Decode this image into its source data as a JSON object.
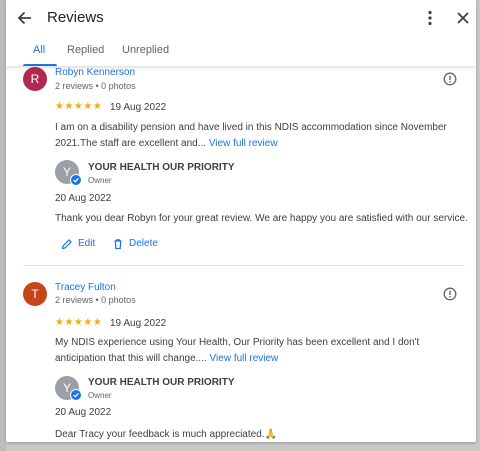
{
  "header": {
    "title": "Reviews",
    "back_icon": "arrow-left-icon",
    "more_icon": "more-vert-icon",
    "close_icon": "close-icon"
  },
  "tabs": [
    {
      "label": "All",
      "active": true
    },
    {
      "label": "Replied",
      "active": false
    },
    {
      "label": "Unreplied",
      "active": false
    }
  ],
  "colors": {
    "accent": "#1a73e8",
    "star": "#f9ab00"
  },
  "reviews": [
    {
      "avatar_letter": "R",
      "avatar_color": "#b0294f",
      "name": "Robyn Kennerson",
      "meta": "2 reviews • 0 photos",
      "rating": 5,
      "stars": "★★★★★",
      "date": "19 Aug 2022",
      "text": "I am on a disability pension and have lived in this NDIS accommodation since November 2021.The staff are excellent and...",
      "more_link": "View full review",
      "reply": {
        "avatar_letter": "Y",
        "owner_name": "YOUR HEALTH OUR PRIORITY",
        "role": "Owner",
        "date": "20 Aug 2022",
        "text": "Thank you dear Robyn for your great review. We are happy you are satisfied with our service."
      },
      "actions": {
        "edit": "Edit",
        "delete": "Delete"
      }
    },
    {
      "avatar_letter": "T",
      "avatar_color": "#c4461a",
      "name": "Tracey Fulton",
      "meta": "2 reviews • 0 photos",
      "rating": 5,
      "stars": "★★★★★",
      "date": "19 Aug 2022",
      "text": "My NDIS experience using Your Health, Our Priority has been excellent and I don't anticipation that this will change....",
      "more_link": "View full review",
      "reply": {
        "avatar_letter": "Y",
        "owner_name": "YOUR HEALTH OUR PRIORITY",
        "role": "Owner",
        "date": "20 Aug 2022",
        "text": "Dear Tracy your feedback is much appreciated.🙏"
      }
    }
  ]
}
